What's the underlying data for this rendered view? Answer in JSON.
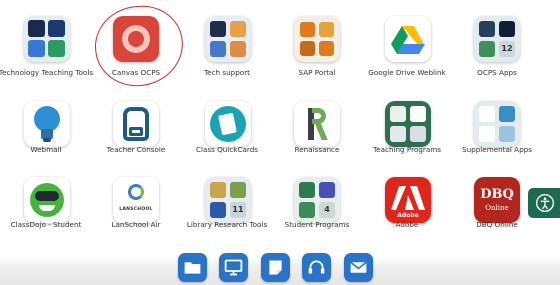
{
  "apps": [
    {
      "id": "technology-teaching-tools",
      "label": "Technology Teaching Tools",
      "icon": "folder-icon"
    },
    {
      "id": "canvas-ocps",
      "label": "Canvas OCPS",
      "icon": "canvas-icon"
    },
    {
      "id": "tech-support",
      "label": "Tech support",
      "icon": "folder-icon"
    },
    {
      "id": "sap-portal",
      "label": "SAP Portal",
      "icon": "sap-icon"
    },
    {
      "id": "google-drive-weblink",
      "label": "Google Drive Weblink",
      "icon": "google-drive-icon"
    },
    {
      "id": "ocps-apps",
      "label": "OCPS Apps",
      "icon": "folder-icon",
      "badge": "12"
    },
    {
      "id": "webmail",
      "label": "Webmail",
      "icon": "bulb-icon"
    },
    {
      "id": "teacher-console",
      "label": "Teacher Console",
      "icon": "backpack-icon"
    },
    {
      "id": "class-quickcards",
      "label": "Class QuickCards",
      "icon": "quickcards-icon"
    },
    {
      "id": "renaissance",
      "label": "Renaissance",
      "icon": "renaissance-icon"
    },
    {
      "id": "teaching-programs",
      "label": "Teaching Programs",
      "icon": "folder-icon"
    },
    {
      "id": "supplemental-apps",
      "label": "Supplemental Apps",
      "icon": "folder-icon"
    },
    {
      "id": "classdojo-student",
      "label": "ClassDojo - Student",
      "icon": "classdojo-icon"
    },
    {
      "id": "lanschool-air",
      "label": "LanSchool Air",
      "icon": "lanschool-icon",
      "icon_text": "LANSCHOOL"
    },
    {
      "id": "library-research-tools",
      "label": "Library Research Tools",
      "icon": "folder-icon",
      "badge": "11"
    },
    {
      "id": "student-programs",
      "label": "Student Programs",
      "icon": "folder-icon",
      "badge": "4"
    },
    {
      "id": "adobe",
      "label": "Adobe",
      "icon": "adobe-icon",
      "icon_text": "Adobe"
    },
    {
      "id": "dbq-online",
      "label": "DBQ Online",
      "icon": "dbq-icon",
      "icon_text": "DBQ",
      "icon_subtext": "Online"
    }
  ],
  "dock": [
    {
      "id": "files",
      "icon": "folder-icon"
    },
    {
      "id": "whiteboard",
      "icon": "presentation-icon"
    },
    {
      "id": "notes",
      "icon": "note-icon"
    },
    {
      "id": "support",
      "icon": "headset-icon"
    },
    {
      "id": "mail",
      "icon": "mail-icon"
    }
  ],
  "accessibility": {
    "icon": "accessibility-icon"
  },
  "colors": {
    "accent_green": "#2f6e51",
    "dock_blue": "#2a74c8",
    "annotation_red": "#d22a2a",
    "canvas_red": "#d9453a"
  }
}
